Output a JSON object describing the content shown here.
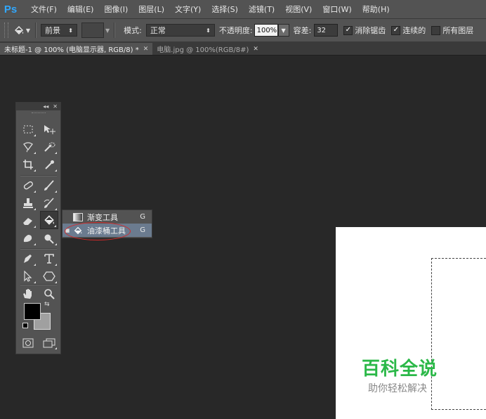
{
  "app": {
    "logo": "Ps"
  },
  "menu": [
    "文件(F)",
    "编辑(E)",
    "图像(I)",
    "图层(L)",
    "文字(Y)",
    "选择(S)",
    "滤镜(T)",
    "视图(V)",
    "窗口(W)",
    "帮助(H)"
  ],
  "options": {
    "fill_source": "前景",
    "mode_label": "模式:",
    "mode_value": "正常",
    "opacity_label": "不透明度:",
    "opacity_value": "100%",
    "tolerance_label": "容差:",
    "tolerance_value": "32",
    "antialias_label": "消除锯齿",
    "antialias_checked": true,
    "contiguous_label": "连续的",
    "contiguous_checked": true,
    "all_layers_label": "所有图层",
    "all_layers_checked": false
  },
  "tabs": [
    {
      "label": "未标题-1 @ 100% (电脑显示器, RGB/8) *",
      "active": true
    },
    {
      "label": "电脑.jpg @ 100%(RGB/8#)",
      "active": false
    }
  ],
  "toolbox": {
    "tools": [
      "rectangular-marquee",
      "move",
      "lasso",
      "quick-selection",
      "crop",
      "eyedropper",
      "healing-brush",
      "brush",
      "clone-stamp",
      "history-brush",
      "eraser",
      "paint-bucket",
      "blur",
      "dodge",
      "pen",
      "type",
      "path-selection",
      "shape",
      "hand",
      "zoom"
    ],
    "foreground_color": "#000000",
    "background_color": "#a0a0a0"
  },
  "flyout": {
    "items": [
      {
        "label": "渐变工具",
        "key": "G",
        "selected": false
      },
      {
        "label": "油漆桶工具",
        "key": "G",
        "selected": true
      }
    ]
  },
  "watermark": {
    "title": "百科全说",
    "subtitle": "助你轻松解决",
    "color": "#2bb848"
  }
}
